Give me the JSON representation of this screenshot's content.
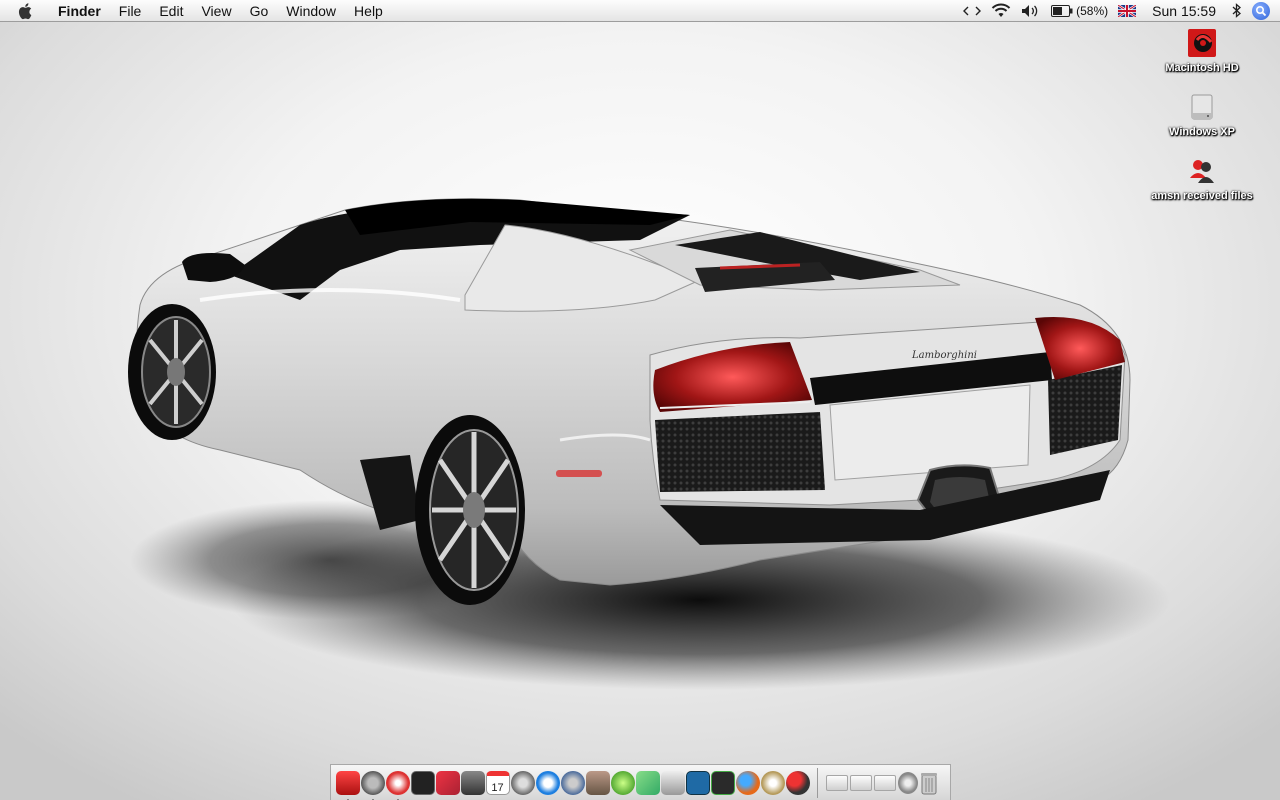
{
  "menubar": {
    "app_name": "Finder",
    "menus": [
      "File",
      "Edit",
      "View",
      "Go",
      "Window",
      "Help"
    ],
    "status": {
      "battery_percent": "(58%)",
      "clock": "Sun 15:59"
    }
  },
  "desktop": {
    "icons": [
      {
        "label": "Macintosh HD",
        "icon": "hard-drive-icon"
      },
      {
        "label": "Windows XP",
        "icon": "disk-icon"
      },
      {
        "label": "amsn received files",
        "icon": "amsn-folder-icon"
      }
    ],
    "wallpaper": {
      "subject": "silver Lamborghini Murcielago Roadster",
      "badge": "Lamborghini"
    }
  },
  "dock": {
    "apps": [
      {
        "icon": "finder-icon",
        "color": "#d9261c",
        "running": true
      },
      {
        "icon": "system-preferences-icon",
        "color": "#707070",
        "running": true
      },
      {
        "icon": "safari-icon",
        "color": "#cc2b2b",
        "running": true
      },
      {
        "icon": "terminal-icon",
        "color": "#222222"
      },
      {
        "icon": "photo-booth-icon",
        "color": "#c93345"
      },
      {
        "icon": "textedit-icon",
        "color": "#5a5a5a"
      },
      {
        "icon": "calendar-icon",
        "color": "#e74c3c",
        "text": "17"
      },
      {
        "icon": "sync-icon",
        "color": "#6a6a6a"
      },
      {
        "icon": "quicktime-icon",
        "color": "#1e7fe0"
      },
      {
        "icon": "itunes-icon",
        "color": "#4a6a9a"
      },
      {
        "icon": "iphoto-icon",
        "color": "#8a6a5a"
      },
      {
        "icon": "lime-icon",
        "color": "#7ac943"
      },
      {
        "icon": "maps-icon",
        "color": "#4caf50"
      },
      {
        "icon": "script-editor-icon",
        "color": "#9aa0a8"
      },
      {
        "icon": "dashboard-icon",
        "color": "#1f6aa5"
      },
      {
        "icon": "scanner-icon",
        "color": "#2a2a2a"
      },
      {
        "icon": "firefox-icon",
        "color": "#e66a1a"
      },
      {
        "icon": "adium-icon",
        "color": "#b59a5a"
      },
      {
        "icon": "amsn-icon",
        "color": "#c42424"
      }
    ],
    "stacks": 3,
    "stack_items": [
      {
        "icon": "documents-stack-icon"
      },
      {
        "icon": "downloads-stack-icon"
      },
      {
        "icon": "applications-stack-icon"
      },
      {
        "icon": "utility-icon"
      },
      {
        "icon": "trash-icon"
      }
    ]
  }
}
